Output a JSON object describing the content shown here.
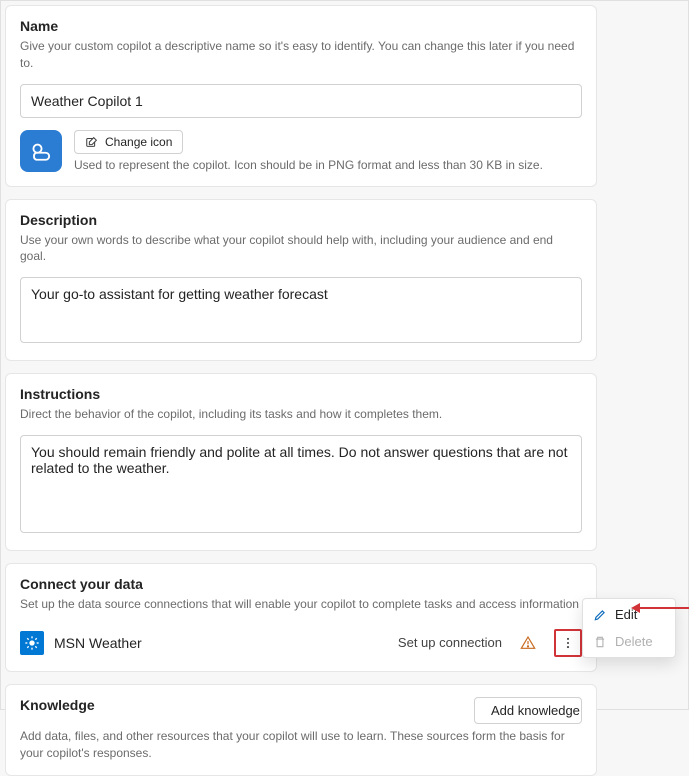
{
  "name_section": {
    "title": "Name",
    "desc": "Give your custom copilot a descriptive name so it's easy to identify. You can change this later if you need to.",
    "value": "Weather Copilot 1",
    "change_icon_label": "Change icon",
    "icon_desc": "Used to represent the copilot. Icon should be in PNG format and less than 30 KB in size."
  },
  "description_section": {
    "title": "Description",
    "desc": "Use your own words to describe what your copilot should help with, including your audience and end goal.",
    "value": "Your go-to assistant for getting weather forecast"
  },
  "instructions_section": {
    "title": "Instructions",
    "desc": "Direct the behavior of the copilot, including its tasks and how it completes them.",
    "value": "You should remain friendly and polite at all times. Do not answer questions that are not related to the weather."
  },
  "connect_section": {
    "title": "Connect your data",
    "desc": "Set up the data source connections that will enable your copilot to complete tasks and access information",
    "connection_name": "MSN Weather",
    "setup_label": "Set up connection"
  },
  "knowledge_section": {
    "title": "Knowledge",
    "desc": "Add data, files, and other resources that your copilot will use to learn. These sources form the basis for your copilot's responses.",
    "add_label": "Add knowledge"
  },
  "context_menu": {
    "edit": "Edit",
    "delete": "Delete"
  }
}
